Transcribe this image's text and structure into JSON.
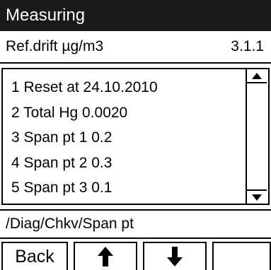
{
  "header": {
    "title": "Measuring"
  },
  "subheader": {
    "label": "Ref.drift µg/m3",
    "menu_number": "3.1.1"
  },
  "list": {
    "items": [
      {
        "label": "1 Reset at 24.10.2010"
      },
      {
        "label": "2  Total Hg 0.0020"
      },
      {
        "label": "3  Span pt 1 0.2"
      },
      {
        "label": "4  Span pt 2 0.3"
      },
      {
        "label": "5  Span pt 3 0.1"
      }
    ]
  },
  "scrollbar": {
    "up_icon": "triangle-up-icon",
    "down_icon": "triangle-down-icon"
  },
  "path": {
    "text": "/Diag/Chkv/Span pt"
  },
  "softkeys": {
    "back_label": "Back",
    "up_icon": "arrow-up-icon",
    "down_icon": "arrow-down-icon",
    "fourth_label": ""
  }
}
